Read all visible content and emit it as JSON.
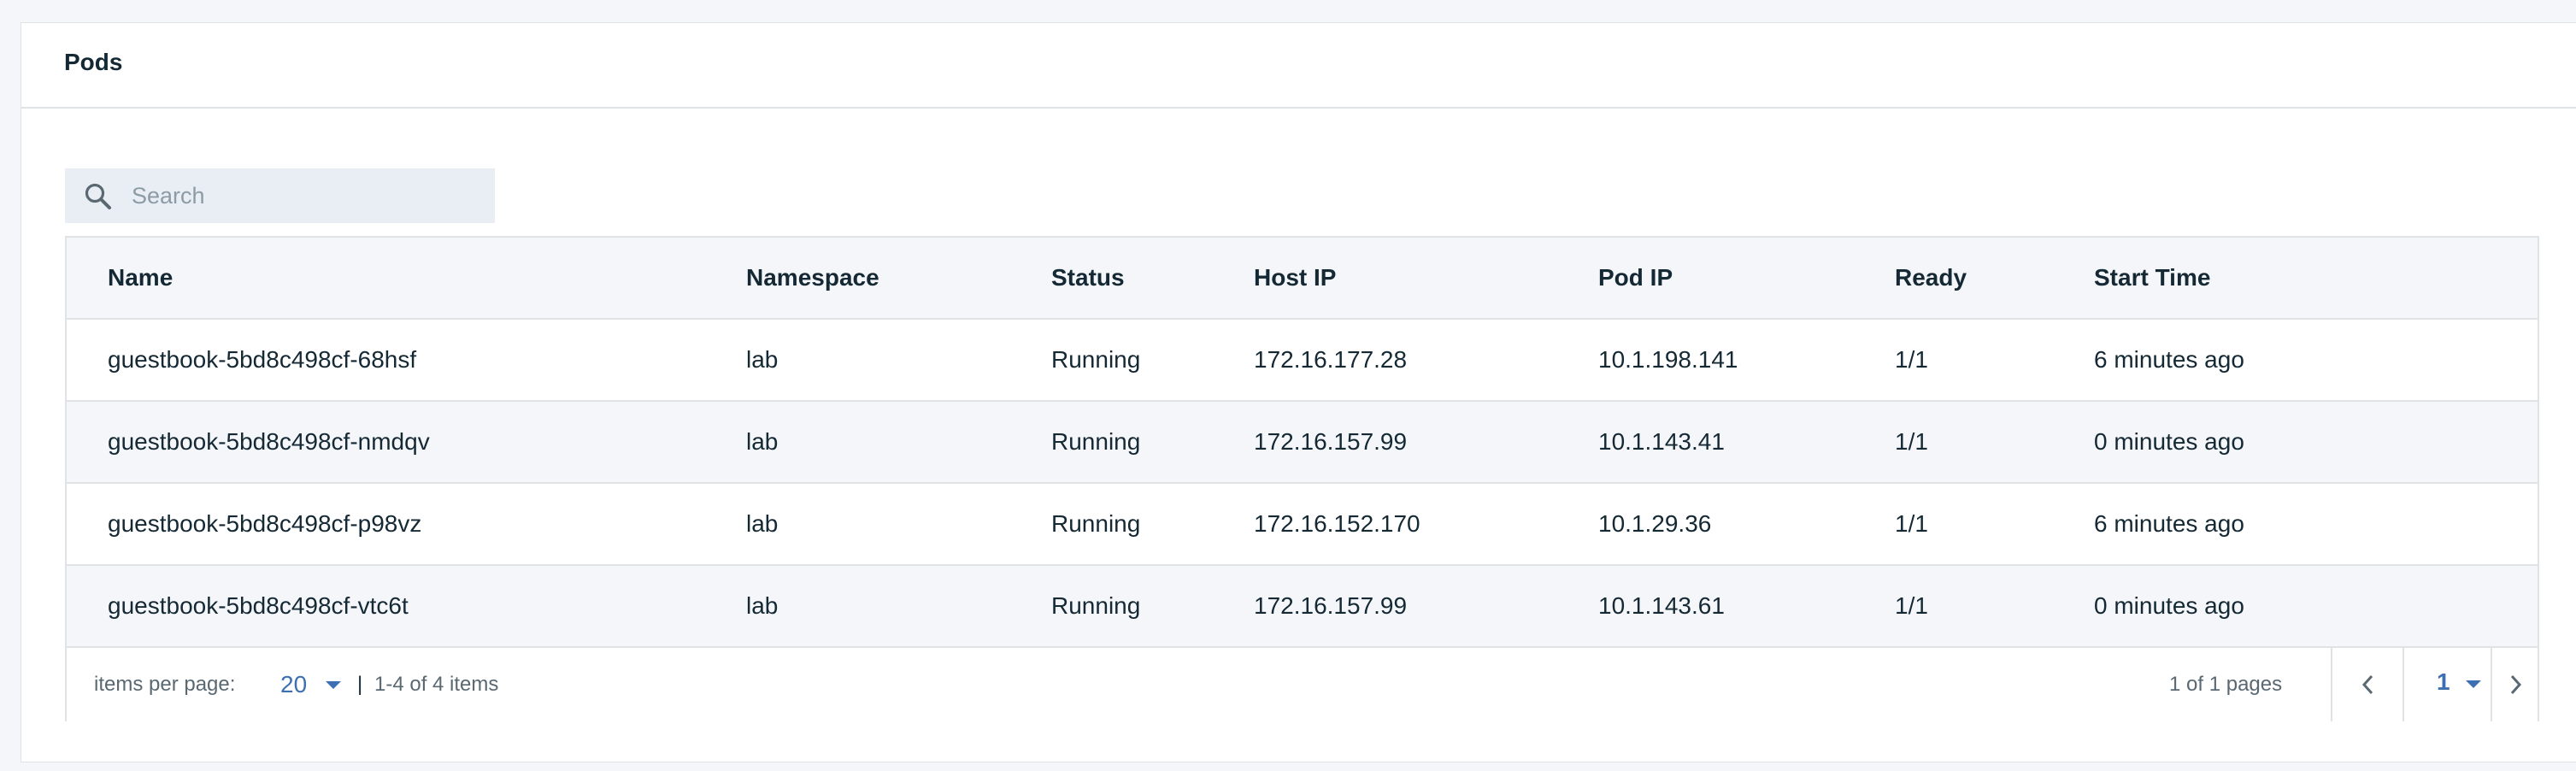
{
  "card": {
    "title": "Pods"
  },
  "search": {
    "placeholder": "Search",
    "value": ""
  },
  "table": {
    "columns": [
      "Name",
      "Namespace",
      "Status",
      "Host IP",
      "Pod IP",
      "Ready",
      "Start Time"
    ],
    "rows": [
      [
        "guestbook-5bd8c498cf-68hsf",
        "lab",
        "Running",
        "172.16.177.28",
        "10.1.198.141",
        "1/1",
        "6 minutes ago"
      ],
      [
        "guestbook-5bd8c498cf-nmdqv",
        "lab",
        "Running",
        "172.16.157.99",
        "10.1.143.41",
        "1/1",
        "0 minutes ago"
      ],
      [
        "guestbook-5bd8c498cf-p98vz",
        "lab",
        "Running",
        "172.16.152.170",
        "10.1.29.36",
        "1/1",
        "6 minutes ago"
      ],
      [
        "guestbook-5bd8c498cf-vtc6t",
        "lab",
        "Running",
        "172.16.157.99",
        "10.1.143.61",
        "1/1",
        "0 minutes ago"
      ]
    ]
  },
  "pagination": {
    "items_per_page_label": "items per page:",
    "items_per_page_value": "20",
    "separator": "|",
    "range_text": "1-4 of 4 items",
    "pages_text": "1 of 1 pages",
    "current_page": "1"
  },
  "icons": {
    "search": "search-icon",
    "prev": "chevron-left-icon",
    "next": "chevron-right-icon",
    "dropdown": "caret-down-icon"
  },
  "colors": {
    "accent": "#3d70b2",
    "text": "#152935",
    "muted": "#5a6872",
    "row_alt": "#f4f6f9",
    "search_bg": "#e9eef4",
    "border": "#dfe3e6"
  }
}
